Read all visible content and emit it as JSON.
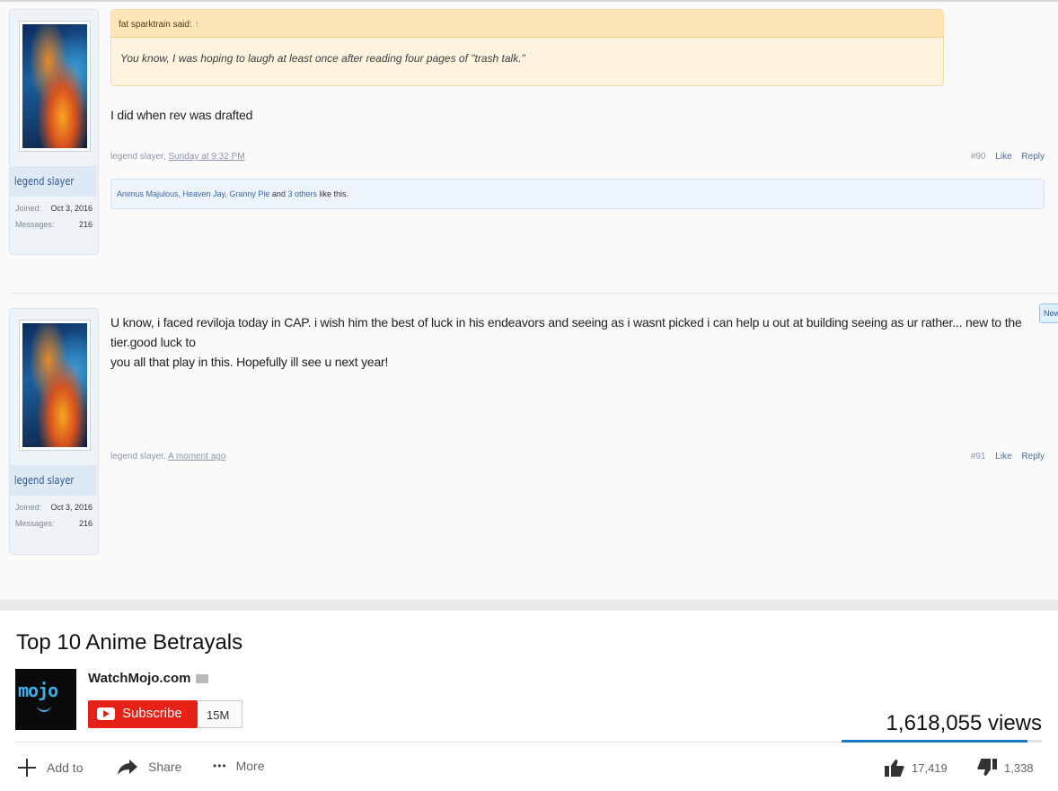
{
  "post90": {
    "username": "legend slayer",
    "joined_label": "Joined:",
    "joined_value": "Oct 3, 2016",
    "messages_label": "Messages:",
    "messages_value": "216",
    "quote_author": "fat sparktrain said:",
    "quote_arrow": "↑",
    "quote_text": "You know, I was hoping to laugh at least once after reading four pages of \"trash talk.\"",
    "message": "I did when rev was drafted",
    "meta_author": "legend slayer, ",
    "meta_time": "Sunday at 9:32 PM",
    "post_number": "#90",
    "like_label": "Like",
    "reply_label": "Reply",
    "likes_names": "Animus Majulous, Heaven Jay, Granny Pie",
    "likes_and": " and ",
    "likes_others": "3 others",
    "likes_suffix": " like this."
  },
  "post91": {
    "username": "legend slayer",
    "joined_label": "Joined:",
    "joined_value": "Oct 3, 2016",
    "messages_label": "Messages:",
    "messages_value": "216",
    "message_line1": "U know, i faced reviloja today in CAP. i wish him the best of luck in his endeavors and seeing as i wasnt picked i can help u out at building seeing as ur rather... new to the tier.good luck to",
    "message_line2": "you all that play in this. Hopefully ill see u next year!",
    "meta_author": "legend slayer, ",
    "meta_time": "A moment ago",
    "post_number": "#91",
    "like_label": "Like",
    "reply_label": "Reply",
    "new_badge": "New"
  },
  "video": {
    "title": "Top 10 Anime Betrayals",
    "logo_text": "mojo",
    "channel": "WatchMojo.com",
    "subscribe_label": "Subscribe",
    "subscriber_count": "15M",
    "views": "1,618,055 views",
    "like_ratio": 0.93,
    "add_to_label": "Add to",
    "share_label": "Share",
    "more_label": "More",
    "more_icon": "•••",
    "likes": "17,419",
    "dislikes": "1,338",
    "accent_color": "#e62117",
    "bar_color": "#167ac6"
  }
}
